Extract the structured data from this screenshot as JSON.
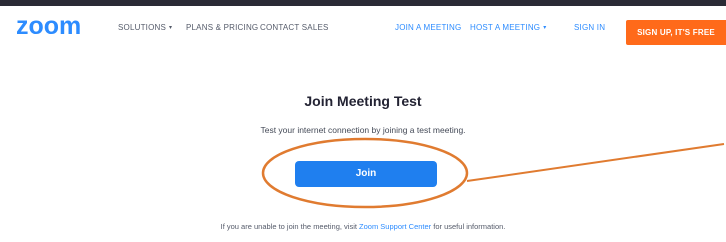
{
  "brand": {
    "logo_text": "zoom",
    "logo_color": "#2d8cff"
  },
  "nav": {
    "solutions": "SOLUTIONS",
    "plans": "PLANS & PRICING",
    "contact": "CONTACT SALES",
    "join": "JOIN A MEETING",
    "host": "HOST A MEETING",
    "signin": "SIGN IN",
    "signup": "SIGN UP, IT'S FREE",
    "caret": "▾"
  },
  "main": {
    "title": "Join Meeting Test",
    "description": "Test your internet connection by joining a test meeting.",
    "join_label": "Join"
  },
  "footer": {
    "before": "If you are unable to join the meeting, visit ",
    "link": "Zoom Support Center",
    "after": " for useful information."
  },
  "colors": {
    "accent": "#2d8cff",
    "signup": "#ff6a1a",
    "join_button": "#1f7fef",
    "annotation": "#e07b30"
  }
}
